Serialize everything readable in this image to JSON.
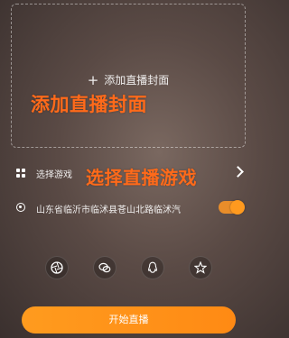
{
  "cover": {
    "plus_icon": "plus-icon",
    "add_label": "添加直播封面",
    "annotation": "添加直播封面"
  },
  "game": {
    "icon": "grid-icon",
    "label": "选择游戏",
    "annotation": "选择直播游戏",
    "chevron_icon": "chevron-right-icon"
  },
  "location": {
    "icon": "location-pin-icon",
    "label": "山东省临沂市临沭县苍山北路临沭汽",
    "toggle_on": true
  },
  "share": {
    "icons": [
      "moments-icon",
      "wechat-icon",
      "qq-icon",
      "qzone-icon"
    ]
  },
  "start": {
    "label": "开始直播"
  },
  "colors": {
    "accent": "#ff8a14",
    "annotation": "#ff6a1a"
  }
}
